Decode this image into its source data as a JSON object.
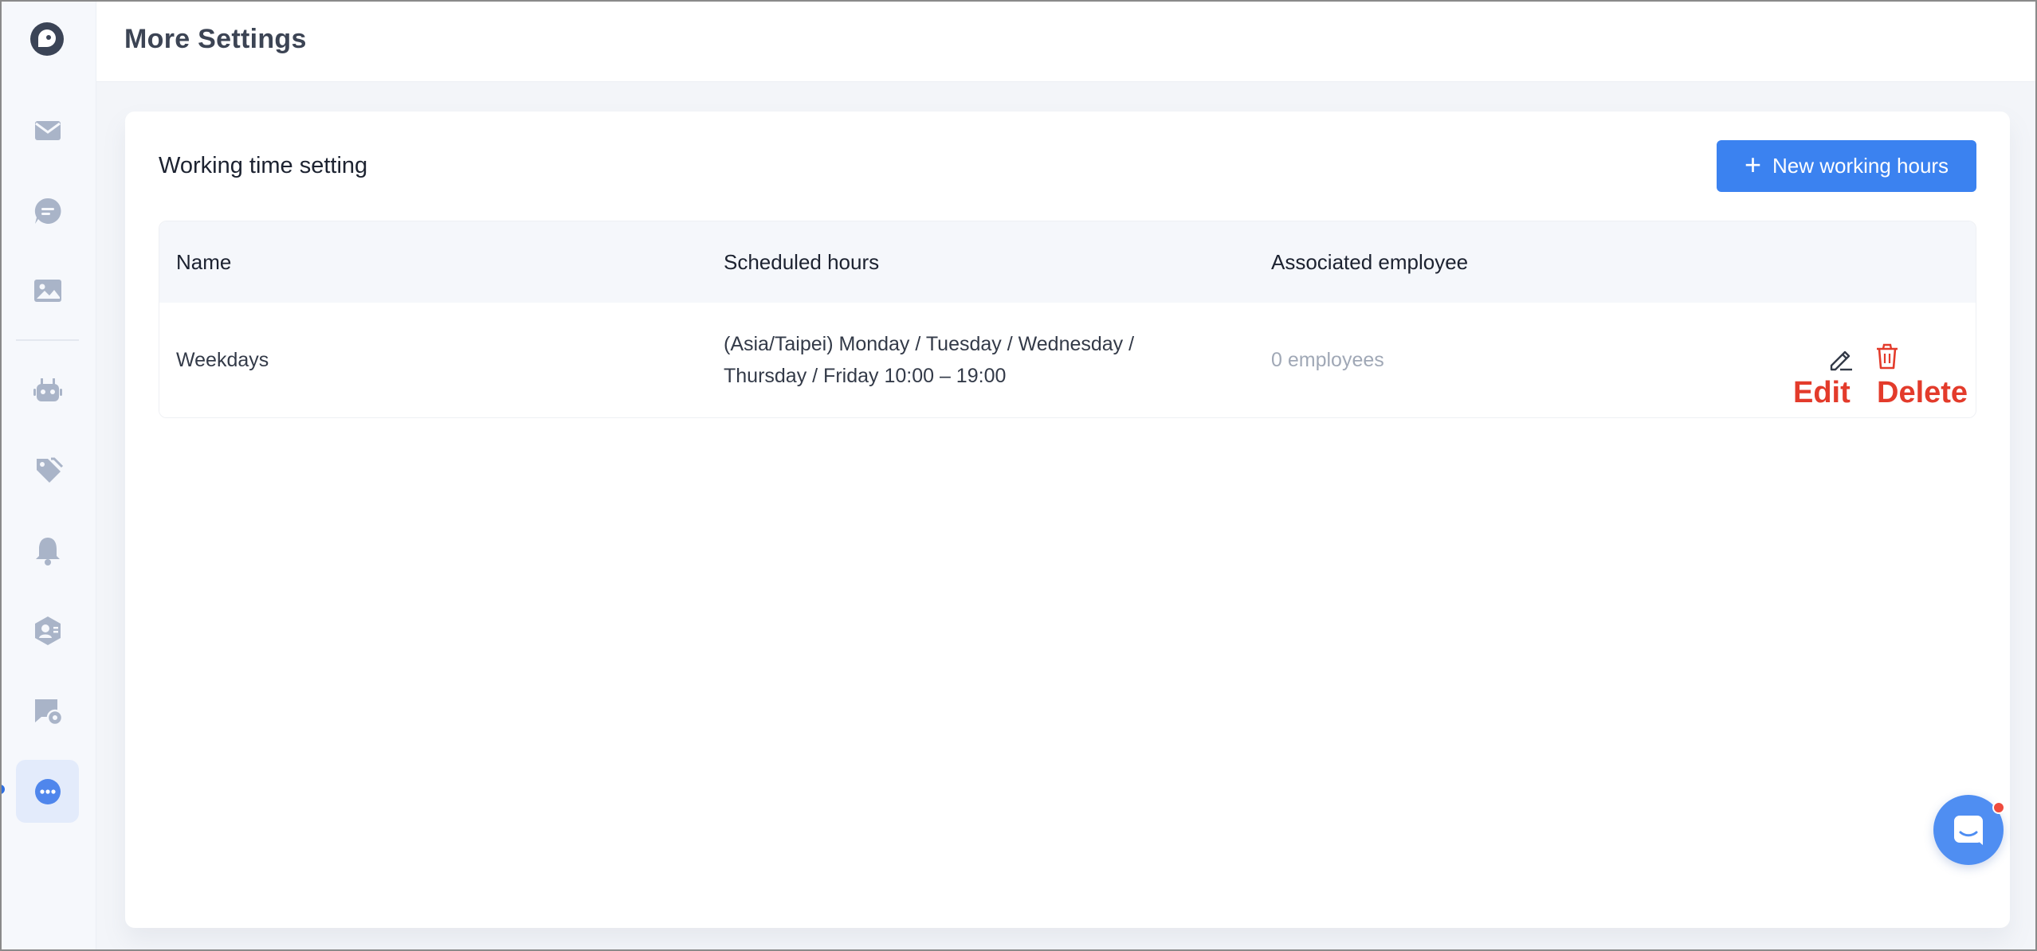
{
  "header": {
    "title": "More Settings"
  },
  "sidebar": {
    "items": [
      {
        "icon": "mail-icon"
      },
      {
        "icon": "chat-bubble-icon"
      },
      {
        "icon": "image-icon"
      },
      {
        "icon": "robot-icon"
      },
      {
        "icon": "tags-icon"
      },
      {
        "icon": "bell-icon"
      },
      {
        "icon": "user-shield-icon"
      },
      {
        "icon": "chat-settings-icon"
      },
      {
        "icon": "more-icon",
        "active": true
      }
    ]
  },
  "card": {
    "title": "Working time setting",
    "new_button_label": "New working hours",
    "columns": [
      "Name",
      "Scheduled hours",
      "Associated employee"
    ],
    "rows": [
      {
        "name": "Weekdays",
        "scheduled_line1": "(Asia/Taipei) Monday / Tuesday / Wednesday /",
        "scheduled_line2": "Thursday / Friday 10:00 – 19:00",
        "employees": "0 employees"
      }
    ],
    "annotations": {
      "edit": "Edit",
      "delete": "Delete"
    }
  },
  "colors": {
    "accent": "#3b82f0",
    "danger": "#e33b2b",
    "sidebar_icon": "#a9b4c8"
  }
}
